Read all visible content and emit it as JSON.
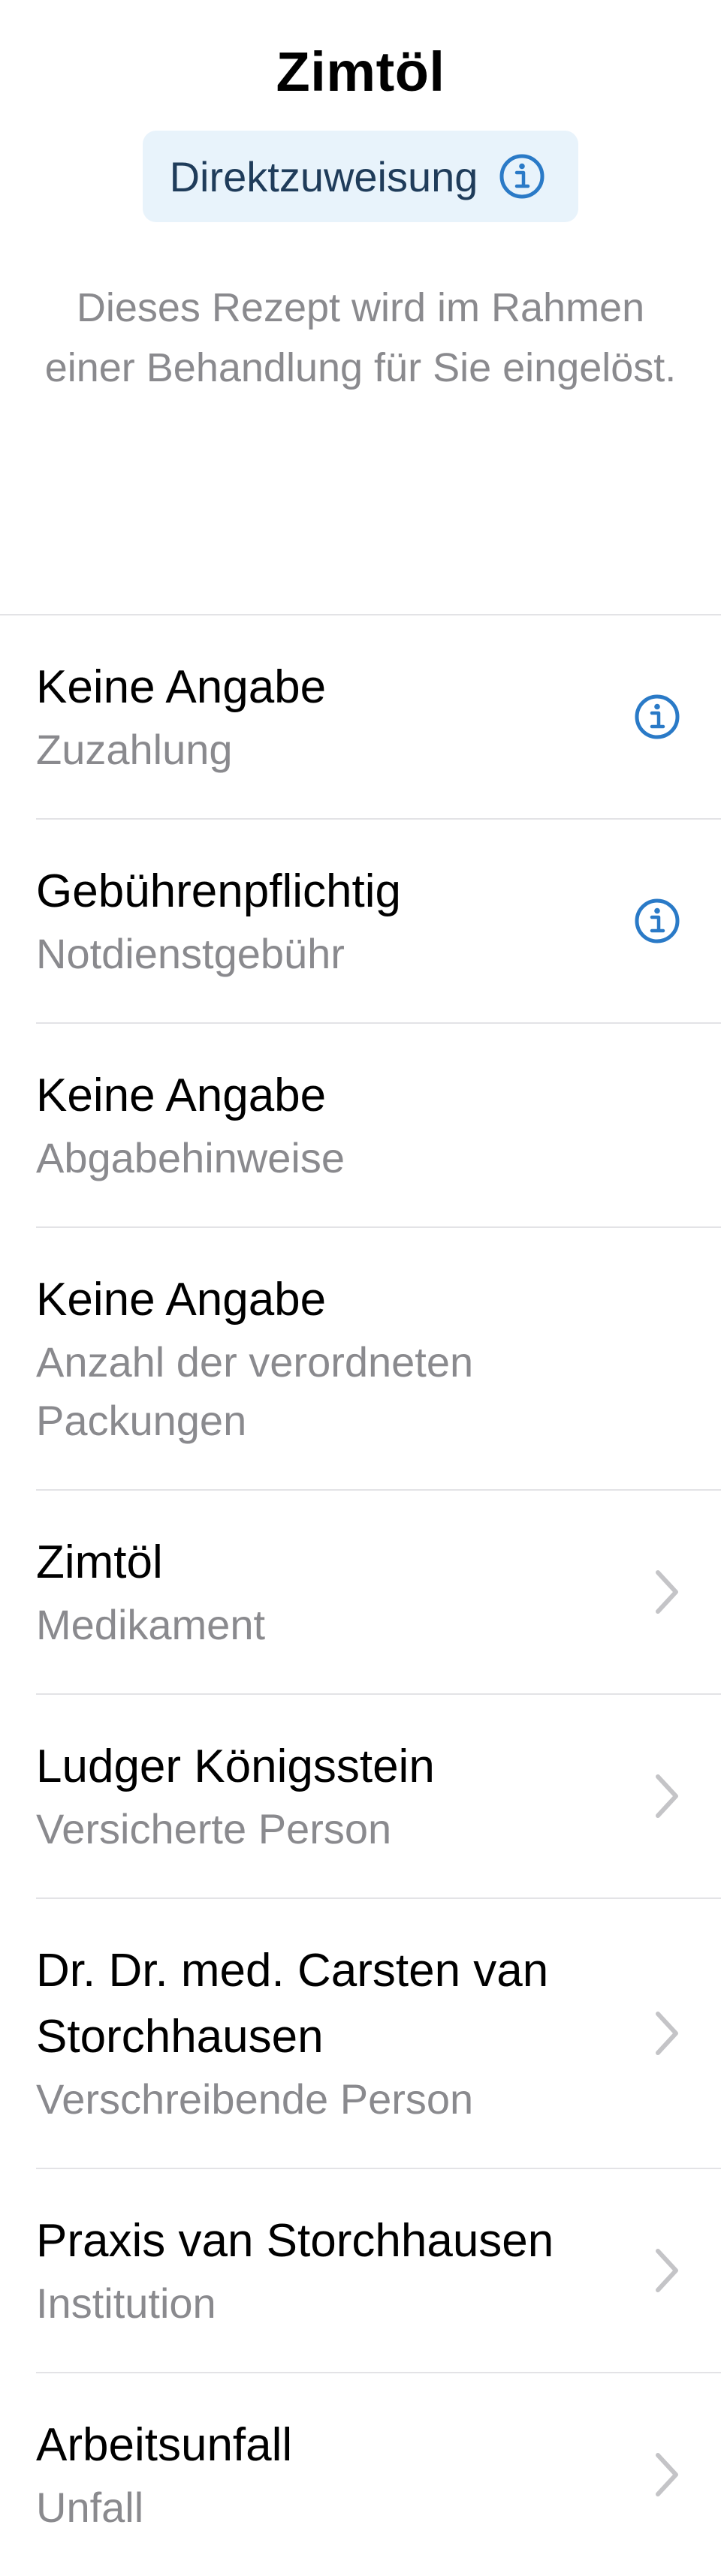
{
  "header": {
    "title": "Zimtöl",
    "badge_label": "Direktzuweisung",
    "description": "Dieses Rezept wird im Rahmen einer Behandlung für Sie eingelöst."
  },
  "rows": [
    {
      "title": "Keine Angabe",
      "subtitle": "Zuzahlung",
      "accessory": "info-icon"
    },
    {
      "title": "Gebührenpflichtig",
      "subtitle": "Notdienstgebühr",
      "accessory": "info-icon"
    },
    {
      "title": "Keine Angabe",
      "subtitle": "Abgabehinweise",
      "accessory": ""
    },
    {
      "title": "Keine Angabe",
      "subtitle": "Anzahl der verordneten Packungen",
      "accessory": ""
    },
    {
      "title": "Zimtöl",
      "subtitle": "Medikament",
      "accessory": "chevron-right-icon"
    },
    {
      "title": "Ludger Königsstein",
      "subtitle": "Versicherte Person",
      "accessory": "chevron-right-icon"
    },
    {
      "title": "Dr. Dr. med. Carsten van Storchhausen",
      "subtitle": "Verschreibende Person",
      "accessory": "chevron-right-icon"
    },
    {
      "title": "Praxis van Storchhausen",
      "subtitle": "Institution",
      "accessory": "chevron-right-icon"
    },
    {
      "title": "Arbeitsunfall",
      "subtitle": "Unfall",
      "accessory": "chevron-right-icon"
    }
  ],
  "colors": {
    "accent": "#2a7ac7",
    "badge_background": "#e8f3fb",
    "badge_text": "#1f3c5a",
    "secondary_text": "#8a8a8e",
    "separator": "#e3e3e6",
    "chevron": "#c4c4c7"
  }
}
